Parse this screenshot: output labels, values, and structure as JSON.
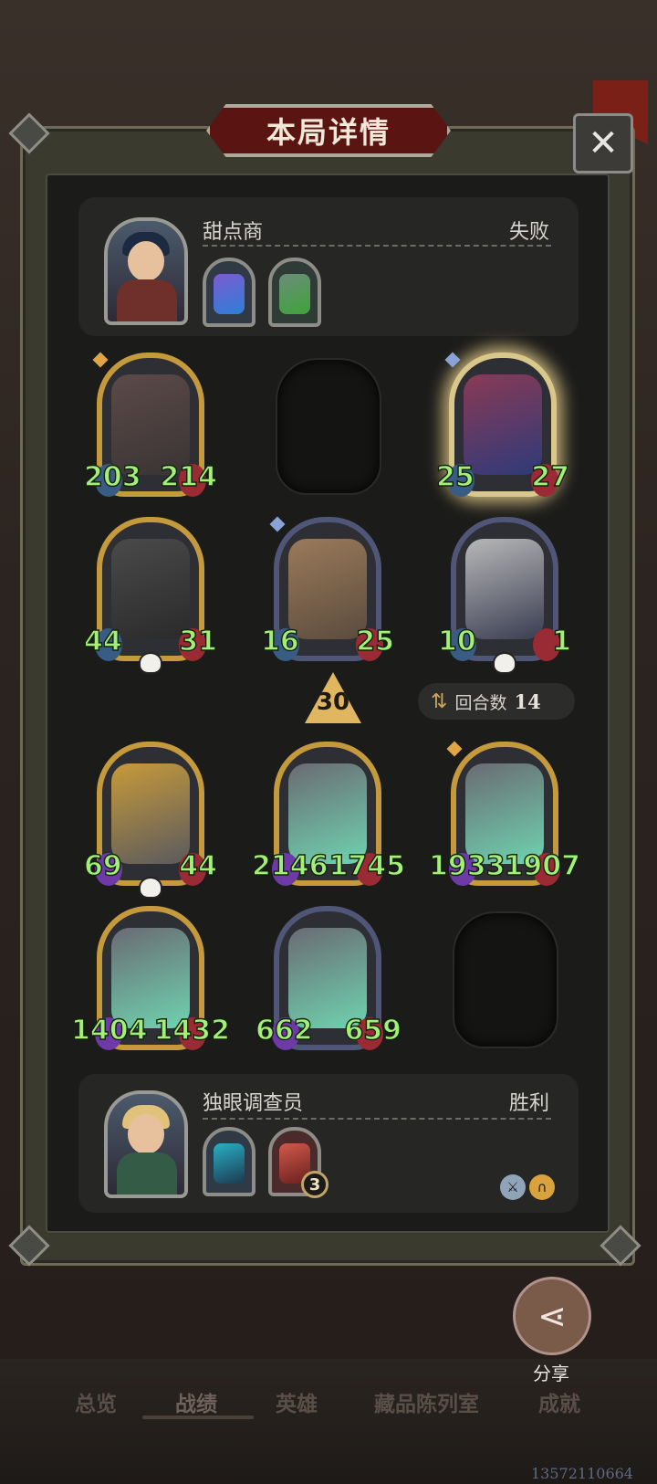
{
  "dialog": {
    "title": "本局详情",
    "close_icon": "close-icon"
  },
  "opponent": {
    "name": "甜点商",
    "result": "失败",
    "relics": [
      "crystal-relic",
      "goblin-relic"
    ]
  },
  "player": {
    "name": "独眼调查员",
    "result": "胜利",
    "relics": [
      "shard-relic",
      "cake-demon-relic"
    ],
    "relic_badge": "3"
  },
  "enemy_board": [
    {
      "attack": "203",
      "health": "214"
    },
    {
      "attack": "25",
      "health": "27"
    },
    {
      "attack": "44",
      "health": "31"
    },
    {
      "attack": "16",
      "health": "25"
    },
    {
      "attack": "10",
      "health": "1"
    }
  ],
  "tier": {
    "value": "30"
  },
  "rounds": {
    "label": "回合数",
    "value": "14"
  },
  "player_board": [
    {
      "attack": "69",
      "health": "44"
    },
    {
      "attack": "2146",
      "health": "1745"
    },
    {
      "attack": "1933",
      "health": "1907"
    },
    {
      "attack": "1404",
      "health": "1432"
    },
    {
      "attack": "662",
      "health": "659"
    }
  ],
  "share": {
    "label": "分享"
  },
  "tabs": [
    {
      "label": "总览"
    },
    {
      "label": "战绩"
    },
    {
      "label": "英雄"
    },
    {
      "label": "藏品陈列室"
    },
    {
      "label": "成就"
    }
  ],
  "watermark": "13572110664",
  "colors": {
    "stat_green": "#a4ef78",
    "gold_frame": "#c49a3c",
    "title_red": "#5a1513"
  }
}
